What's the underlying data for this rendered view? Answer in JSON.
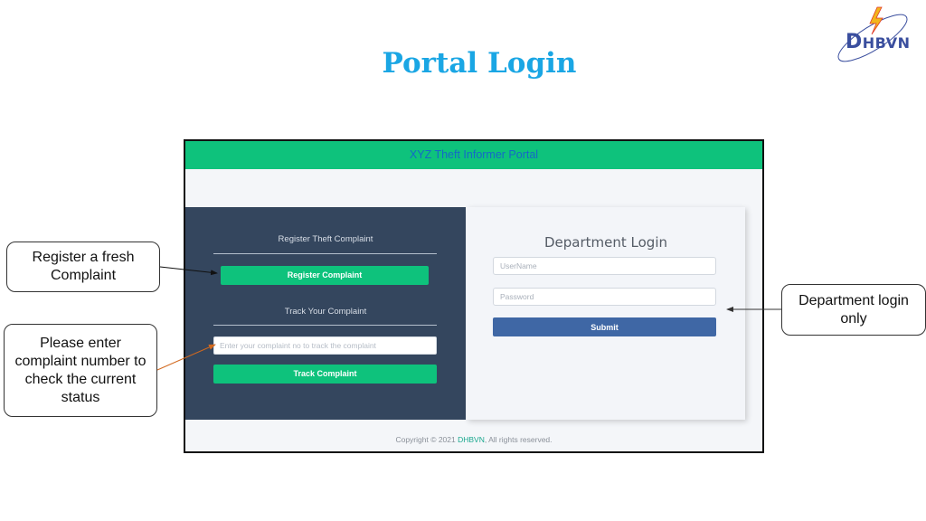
{
  "slide": {
    "title": "Portal Login",
    "logo": {
      "text_big": "D",
      "text_rest": "HBVN",
      "icon": "lightning-bolt-icon"
    }
  },
  "portal": {
    "header_title": "XYZ Theft Informer Portal",
    "left": {
      "register_section_title": "Register Theft Complaint",
      "register_button": "Register Complaint",
      "track_section_title": "Track Your Complaint",
      "track_input_placeholder": "Enter your complaint no to track the complaint",
      "track_input_value": "",
      "track_button": "Track Complaint"
    },
    "right": {
      "title": "Department Login",
      "username_placeholder": "UserName",
      "username_value": "",
      "password_placeholder": "Password",
      "password_value": "",
      "submit_button": "Submit"
    },
    "footer": {
      "prefix": "Copyright © 2021 ",
      "brand": "DHBVN",
      "suffix": ", All rights reserved."
    }
  },
  "callouts": {
    "register": "Register a fresh Complaint",
    "track": "Please enter complaint number to check the current status",
    "department": "Department login only"
  },
  "colors": {
    "title": "#1aa6e4",
    "header_green": "#0ec27c",
    "header_text": "#1569c7",
    "left_panel": "#34465e",
    "submit_blue": "#3f67a5",
    "footer_brand": "#1ba88f",
    "track_arrow": "#d2691e"
  }
}
